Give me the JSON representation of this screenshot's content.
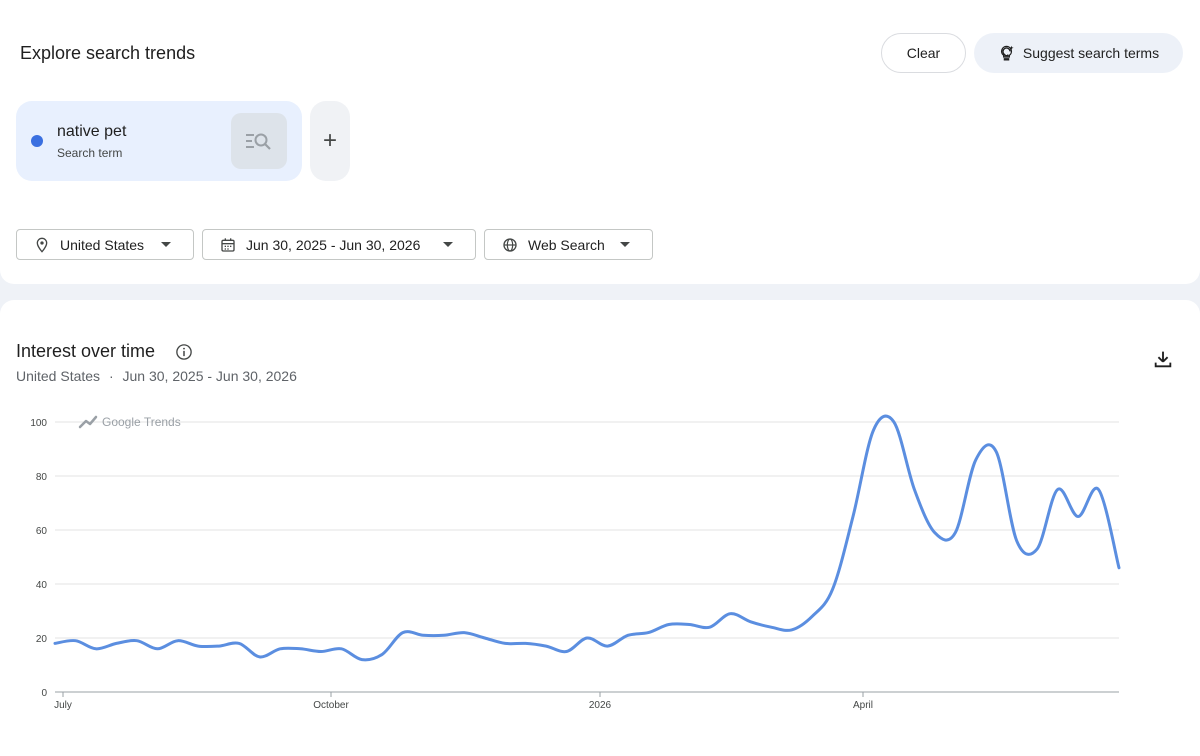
{
  "header": {
    "title": "Explore search trends",
    "clear_label": "Clear",
    "suggest_label": "Suggest search terms"
  },
  "term": {
    "name": "native pet",
    "type_label": "Search term",
    "color": "#3a6fe0",
    "add_label": "+"
  },
  "filters": {
    "location": "United States",
    "date_range": "Jun 30, 2025 - Jun 30, 2026",
    "search_type": "Web Search"
  },
  "chart": {
    "title": "Interest over time",
    "subtitle_location": "United States",
    "subtitle_separator": "·",
    "subtitle_range": "Jun 30, 2025 - Jun 30, 2026",
    "watermark": "Google Trends"
  },
  "chart_data": {
    "type": "line",
    "x_tick_labels": [
      "July",
      "October",
      "2026",
      "April"
    ],
    "y_tick_labels": [
      "100",
      "80",
      "60",
      "40",
      "20",
      "0"
    ],
    "ylim": [
      0,
      100
    ],
    "grid": true,
    "series_color": "#5b8ee0",
    "series": [
      {
        "values": [
          18,
          19,
          16,
          18,
          19,
          16,
          19,
          17,
          17,
          18,
          13,
          16,
          16,
          15,
          16,
          12,
          14,
          22,
          21,
          21,
          22,
          20,
          18,
          18,
          17,
          15,
          20,
          17,
          21,
          22,
          25,
          25,
          24,
          29,
          26,
          24,
          23,
          28,
          38,
          65,
          97,
          100,
          75,
          59,
          59,
          86,
          89,
          56,
          53,
          75,
          65,
          75,
          46
        ]
      }
    ]
  }
}
